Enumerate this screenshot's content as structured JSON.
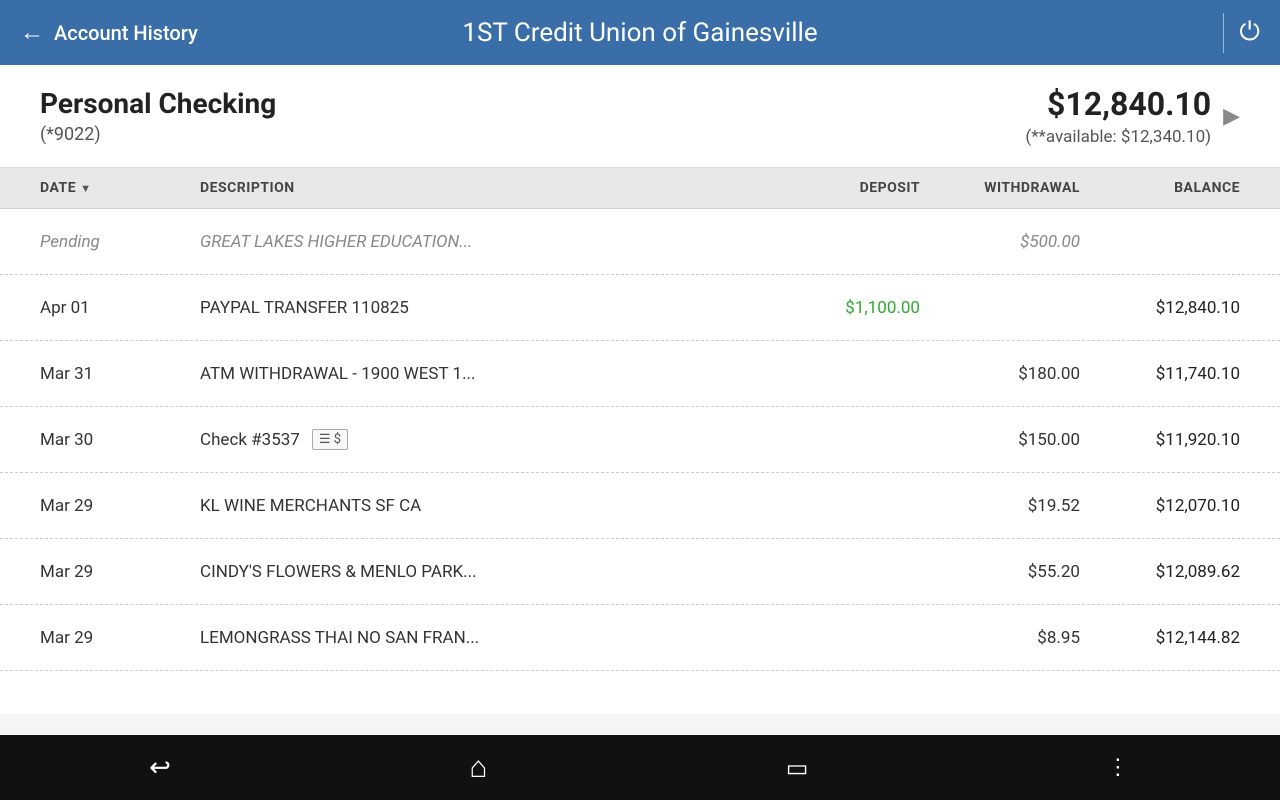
{
  "header": {
    "back_label": "←",
    "title": "1ST Credit Union of Gainesville",
    "page_title": "Account History",
    "power_icon": "⏻"
  },
  "account": {
    "name": "Personal Checking",
    "number": "(*9022)",
    "balance": "$12,840.10",
    "available": "(**available: $12,340.10)"
  },
  "table": {
    "columns": [
      "DATE",
      "DESCRIPTION",
      "DEPOSIT",
      "WITHDRAWAL",
      "BALANCE"
    ],
    "rows": [
      {
        "date": "Pending",
        "description": "GREAT LAKES HIGHER EDUCATION...",
        "deposit": "",
        "withdrawal": "$500.00",
        "balance": "",
        "pending": true,
        "has_check": false,
        "deposit_green": false
      },
      {
        "date": "Apr 01",
        "description": "PAYPAL TRANSFER 110825",
        "deposit": "$1,100.00",
        "withdrawal": "",
        "balance": "$12,840.10",
        "pending": false,
        "has_check": false,
        "deposit_green": true
      },
      {
        "date": "Mar 31",
        "description": "ATM WITHDRAWAL - 1900 WEST 1...",
        "deposit": "",
        "withdrawal": "$180.00",
        "balance": "$11,740.10",
        "pending": false,
        "has_check": false,
        "deposit_green": false
      },
      {
        "date": "Mar 30",
        "description": "Check #3537",
        "deposit": "",
        "withdrawal": "$150.00",
        "balance": "$11,920.10",
        "pending": false,
        "has_check": true,
        "deposit_green": false
      },
      {
        "date": "Mar 29",
        "description": "KL WINE MERCHANTS SF CA",
        "deposit": "",
        "withdrawal": "$19.52",
        "balance": "$12,070.10",
        "pending": false,
        "has_check": false,
        "deposit_green": false
      },
      {
        "date": "Mar 29",
        "description": "CINDY'S FLOWERS & MENLO PARK...",
        "deposit": "",
        "withdrawal": "$55.20",
        "balance": "$12,089.62",
        "pending": false,
        "has_check": false,
        "deposit_green": false
      },
      {
        "date": "Mar 29",
        "description": "LEMONGRASS THAI NO SAN FRAN...",
        "deposit": "",
        "withdrawal": "$8.95",
        "balance": "$12,144.82",
        "pending": false,
        "has_check": false,
        "deposit_green": false
      }
    ]
  },
  "bottom_nav": {
    "back_icon": "↩",
    "home_icon": "⌂",
    "recent_icon": "▭",
    "dots_icon": "⋮"
  }
}
